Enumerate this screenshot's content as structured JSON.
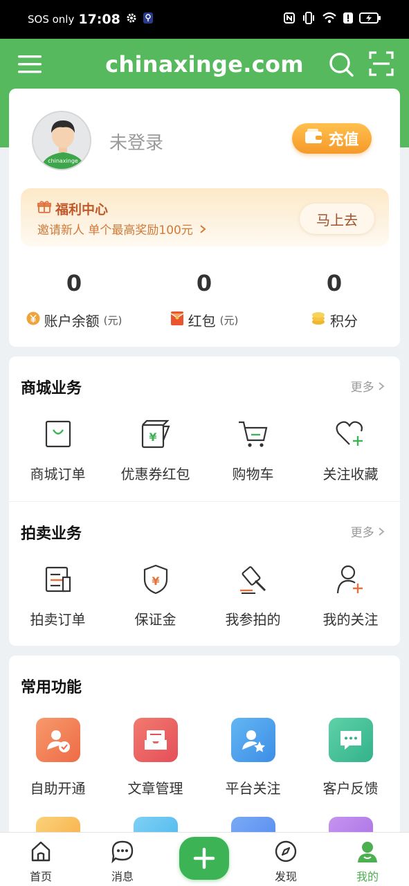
{
  "status_bar": {
    "carrier": "SOS only",
    "time": "17:08"
  },
  "app": {
    "title": "chinaxinge.com"
  },
  "profile": {
    "login_status": "未登录",
    "recharge_label": "充值",
    "avatar_text": "chinaxinge"
  },
  "welfare": {
    "title": "福利中心",
    "subtitle": "邀请新人 单个最高奖励100元",
    "go_label": "马上去"
  },
  "stats": [
    {
      "value": "0",
      "label": "账户余额",
      "unit": "(元)",
      "icon": "yuan-coin-icon"
    },
    {
      "value": "0",
      "label": "红包",
      "unit": "(元)",
      "icon": "red-envelope-icon"
    },
    {
      "value": "0",
      "label": "积分",
      "unit": "",
      "icon": "points-coins-icon"
    }
  ],
  "mall": {
    "title": "商城业务",
    "more": "更多",
    "items": [
      {
        "label": "商城订单",
        "icon": "shopping-bag-icon"
      },
      {
        "label": "优惠券红包",
        "icon": "coupon-icon"
      },
      {
        "label": "购物车",
        "icon": "cart-icon"
      },
      {
        "label": "关注收藏",
        "icon": "heart-plus-icon"
      }
    ]
  },
  "auction": {
    "title": "拍卖业务",
    "more": "更多",
    "items": [
      {
        "label": "拍卖订单",
        "icon": "auction-order-icon"
      },
      {
        "label": "保证金",
        "icon": "deposit-shield-icon"
      },
      {
        "label": "我参拍的",
        "icon": "gavel-icon"
      },
      {
        "label": "我的关注",
        "icon": "user-plus-icon"
      }
    ]
  },
  "functions": {
    "title": "常用功能",
    "items": [
      {
        "label": "自助开通",
        "icon": "self-service-icon"
      },
      {
        "label": "文章管理",
        "icon": "article-manage-icon"
      },
      {
        "label": "平台关注",
        "icon": "platform-follow-icon"
      },
      {
        "label": "客户反馈",
        "icon": "feedback-icon"
      }
    ]
  },
  "nav": [
    {
      "label": "首页",
      "icon": "home-icon"
    },
    {
      "label": "消息",
      "icon": "message-icon"
    },
    {
      "label": "",
      "icon": "plus-icon"
    },
    {
      "label": "发现",
      "icon": "compass-icon"
    },
    {
      "label": "我的",
      "icon": "profile-icon"
    }
  ],
  "colors": {
    "brand_green": "#56b95e",
    "accent_orange": "#f5992a"
  }
}
